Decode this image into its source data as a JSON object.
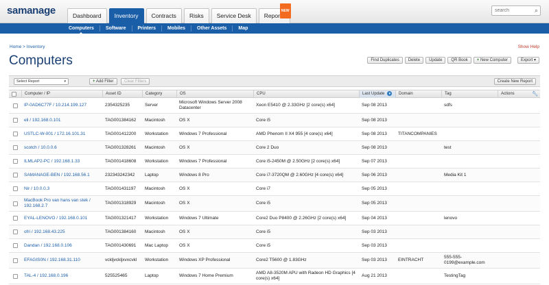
{
  "header": {
    "logo": "samanage",
    "tabs": [
      {
        "label": "Dashboard"
      },
      {
        "label": "Inventory",
        "active": true
      },
      {
        "label": "Contracts"
      },
      {
        "label": "Risks"
      },
      {
        "label": "Service Desk"
      },
      {
        "label": "Reports",
        "badge": "NEW"
      }
    ],
    "search_placeholder": "search"
  },
  "subnav": {
    "items": [
      "Computers",
      "Software",
      "Printers",
      "Mobiles",
      "Other Assets",
      "Map"
    ]
  },
  "breadcrumb": "Home > Inventory",
  "show_help": "Show Help",
  "page_title": "Computers",
  "actions": {
    "find_duplicates": "Find Duplicates",
    "delete": "Delete",
    "update": "Update",
    "qr_book": "QR Book",
    "new_computer": "New Computer",
    "export": "Export"
  },
  "filterbar": {
    "select_report": "Select Report",
    "add_filter": "Add Filter",
    "clear_filters": "Clear Filters",
    "create_new_report": "Create New Report"
  },
  "table": {
    "columns": [
      "Computer / IP",
      "Asset ID",
      "Category",
      "OS",
      "CPU",
      "Last Update",
      "Domain",
      "Tag",
      "Actions"
    ],
    "rows": [
      {
        "computer": "IP-0AD6C77F / 10.214.199.127",
        "asset_id": "2354325235",
        "category": "Server",
        "os": "Microsoft Windows Server 2008 Datacenter",
        "cpu": "Xeon E5410 @ 2.33GHz [2 core(s) x64]",
        "last_update": "Sep 08 2013",
        "domain": "",
        "tag": "sdfs",
        "tall": true
      },
      {
        "computer": "eli / 192.168.0.101",
        "asset_id": "TAG001384162",
        "category": "Macintosh",
        "os": "OS X",
        "cpu": "Core i5",
        "last_update": "Sep 08 2013",
        "domain": "",
        "tag": ""
      },
      {
        "computer": "USTLC-W-001 / 172.16.101.31",
        "asset_id": "TAG001412200",
        "category": "Workstation",
        "os": "Windows 7 Professional",
        "cpu": "AMD Phenom II X4 955 [4 core(s) x64]",
        "last_update": "Sep 08 2013",
        "domain": "TITANCOMPANIES",
        "tag": ""
      },
      {
        "computer": "scotch / 10.0.0.6",
        "asset_id": "TAG001328261",
        "category": "Macintosh",
        "os": "OS X",
        "cpu": "Core 2 Duo",
        "last_update": "Sep 08 2013",
        "domain": "",
        "tag": "test"
      },
      {
        "computer": "ILMLAP2-PC / 192.168.1.33",
        "asset_id": "TAG001418608",
        "category": "Workstation",
        "os": "Windows 7 Professional",
        "cpu": "Core i5-2450M @ 2.50GHz [2 core(s) x64]",
        "last_update": "Sep 07 2013",
        "domain": "",
        "tag": ""
      },
      {
        "computer": "SAMANAGE-BEN / 192.168.56.1",
        "asset_id": "232343242342",
        "category": "Laptop",
        "os": "Windows 8 Pro",
        "cpu": "Core i7-3720QM @ 2.60GHz [4 core(s) x64]",
        "last_update": "Sep 06 2013",
        "domain": "",
        "tag": "Media Kit 1"
      },
      {
        "computer": "Nir / 10.0.0.3",
        "asset_id": "TAG001431197",
        "category": "Macintosh",
        "os": "OS X",
        "cpu": "Core i7",
        "last_update": "Sep 05 2013",
        "domain": "",
        "tag": ""
      },
      {
        "computer": "MacBook Pro van hans van stek / 192.168.2.7",
        "asset_id": "TAG001318929",
        "category": "Macintosh",
        "os": "OS X",
        "cpu": "Core i5",
        "last_update": "Sep 05 2013",
        "domain": "",
        "tag": "",
        "tall": true
      },
      {
        "computer": "EYAL-LENOVO / 192.168.0.101",
        "asset_id": "TAG001321417",
        "category": "Workstation",
        "os": "Windows 7 Ultimate",
        "cpu": "Core2 Duo P8400 @ 2.26GHz [2 core(s) x64]",
        "last_update": "Sep 04 2013",
        "domain": "",
        "tag": "lenovo"
      },
      {
        "computer": "ofri / 192.168.43.225",
        "asset_id": "TAG001384160",
        "category": "Macintosh",
        "os": "OS X",
        "cpu": "Core i5",
        "last_update": "Sep 03 2013",
        "domain": "",
        "tag": ""
      },
      {
        "computer": "Dandan / 192.168.0.106",
        "asset_id": "TAG001430691",
        "category": "Mac Laptop",
        "os": "OS X",
        "cpu": "Core i5",
        "last_update": "Sep 03 2013",
        "domain": "",
        "tag": ""
      },
      {
        "computer": "EFAGIS0N / 192.168.31.110",
        "asset_id": "vckljvckljxvxcvkl",
        "category": "Workstation",
        "os": "Windows XP Professional",
        "cpu": "Core2 T5600 @ 1.83GHz",
        "last_update": "Sep 03 2013",
        "domain": "EINTRACHT",
        "tag": "555-555-0199@example.com",
        "tall": true
      },
      {
        "computer": "TAL-4 / 192.168.0.196",
        "asset_id": "525525465",
        "category": "Laptop",
        "os": "Windows 7 Home Premium",
        "cpu": "AMD A8-3520M APU with Radeon HD Graphics [4 core(s) x64]",
        "last_update": "Aug 21 2013",
        "domain": "",
        "tag": "TestingTag",
        "tall": true
      }
    ]
  }
}
